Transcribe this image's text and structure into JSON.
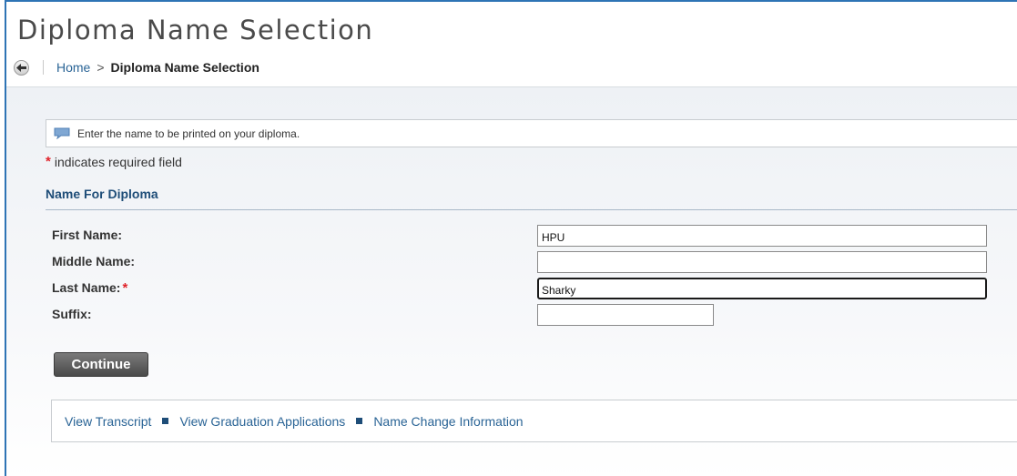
{
  "page": {
    "title": "Diploma Name Selection"
  },
  "breadcrumb": {
    "home": "Home",
    "separator": ">",
    "current": "Diploma Name Selection"
  },
  "info": {
    "message": "Enter the name to be printed on your diploma."
  },
  "required_note": {
    "asterisk": "*",
    "text": "indicates required field"
  },
  "section": {
    "title": "Name For Diploma"
  },
  "form": {
    "first_name": {
      "label": "First Name:",
      "value": "HPU"
    },
    "middle_name": {
      "label": "Middle Name:",
      "value": ""
    },
    "last_name": {
      "label": "Last Name:",
      "required_mark": "*",
      "value": "Sharky"
    },
    "suffix": {
      "label": "Suffix:",
      "value": ""
    }
  },
  "actions": {
    "continue_label": "Continue"
  },
  "footer_links": {
    "transcript": "View Transcript",
    "graduation": "View Graduation Applications",
    "name_change": "Name Change Information"
  },
  "colors": {
    "link": "#2a6496",
    "section_title": "#1e4d78",
    "required": "#e0232a",
    "frame_border": "#2e74b5"
  },
  "icons": {
    "back": "back-arrow-icon",
    "info": "speech-bubble-icon",
    "bullet": "square-bullet-icon"
  }
}
